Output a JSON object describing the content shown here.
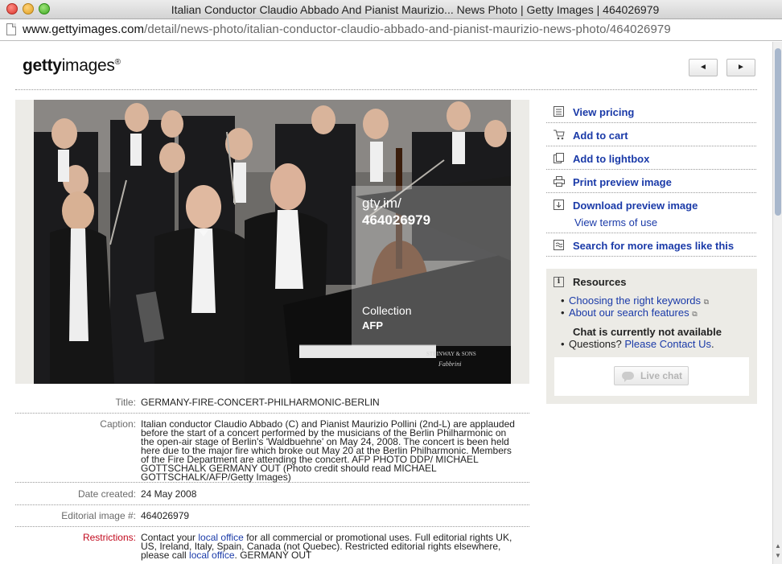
{
  "window": {
    "title": "Italian Conductor Claudio Abbado And Pianist Maurizio... News Photo | Getty Images | 464026979"
  },
  "address_bar": {
    "host": "www.gettyimages.com",
    "path": "/detail/news-photo/italian-conductor-claudio-abbado-and-pianist-maurizio-news-photo/464026979"
  },
  "header": {
    "logo_bold": "getty",
    "logo_light": "images",
    "logo_mark": "®",
    "prev_glyph": "◄",
    "next_glyph": "►"
  },
  "photo": {
    "watermark_domain": "gty.im/",
    "watermark_id": "464026979",
    "watermark_collection": "Collection",
    "watermark_agency": "AFP",
    "piano_brand": "STEINWAY & SONS",
    "piano_dealer": "Fabbrini"
  },
  "details": {
    "title_label": "Title:",
    "title_value": "GERMANY-FIRE-CONCERT-PHILHARMONIC-BERLIN",
    "caption_label": "Caption:",
    "caption_value": "Italian conductor Claudio Abbado (C) and Pianist Maurizio Pollini (2nd-L) are applauded before the start of a concert performed by the musicians of the Berlin Philharmonic on the open-air stage of Berlin's 'Waldbuehne' on May 24, 2008. The concert is been held here due to the major fire which broke out May 20 at the Berlin Philharmonic. Members of the Fire Department are attending the concert. AFP PHOTO DDP/ MICHAEL GOTTSCHALK GERMANY OUT (Photo credit should read MICHAEL GOTTSCHALK/AFP/Getty Images)",
    "date_label": "Date created:",
    "date_value": "24 May 2008",
    "editorial_label": "Editorial image #:",
    "editorial_value": "464026979",
    "restrictions_label": "Restrictions:",
    "restrictions_pre": "Contact your ",
    "restrictions_link1": "local office",
    "restrictions_mid": " for all commercial or promotional uses. Full editorial rights UK, US, Ireland, Italy, Spain, Canada (not Quebec). Restricted editorial rights elsewhere, please call ",
    "restrictions_link2": "local office",
    "restrictions_post": ". GERMANY OUT"
  },
  "actions": {
    "view_pricing": "View pricing",
    "add_to_cart": "Add to cart",
    "add_to_lightbox": "Add to lightbox",
    "print_preview": "Print preview image",
    "download_preview": "Download preview image",
    "view_terms": "View terms of use",
    "search_similar": "Search for more images like this"
  },
  "resources": {
    "title": "Resources",
    "link_keywords": "Choosing the right keywords",
    "link_search_features": "About our search features",
    "chat_status": "Chat is currently not available",
    "questions_text": "Questions? ",
    "contact_link": "Please Contact Us",
    "contact_suffix": ".",
    "live_chat": "Live chat"
  },
  "colors": {
    "link": "#1a3aa8",
    "restrictions_label": "#c20a1e",
    "panel_bg": "#ecebe6"
  }
}
